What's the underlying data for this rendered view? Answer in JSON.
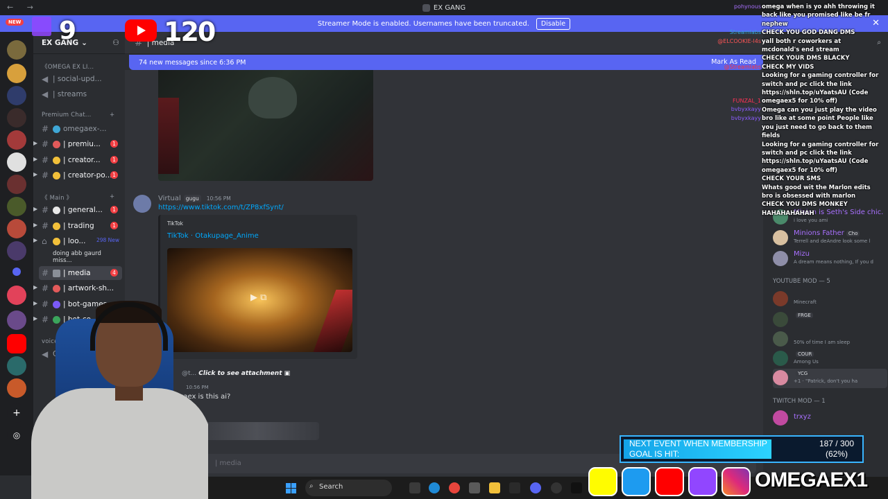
{
  "window": {
    "title": "EX GANG",
    "nav": "← →"
  },
  "banner": {
    "text": "Streamer Mode is enabled. Usernames have been truncated.",
    "button": "Disable",
    "close": "✕"
  },
  "overlay": {
    "twitch_count": "9",
    "youtube_count": "120",
    "new_badge": "NEW"
  },
  "server": {
    "name": "EX GANG"
  },
  "sidebar": {
    "categories": [
      {
        "label": "《OMEGA EX LI..."
      },
      {
        "label": "Premium Chat..."
      },
      {
        "label": "《 Main 》"
      },
      {
        "label": "voice chan"
      }
    ],
    "channels": [
      {
        "label": "| social-upd...",
        "color": "#949ba4"
      },
      {
        "label": "| streams",
        "color": "#949ba4"
      },
      {
        "label": "omegaex-...",
        "color": "#949ba4"
      },
      {
        "label": "| premiu...",
        "badge": "1"
      },
      {
        "label": "| creator...",
        "badge": "1"
      },
      {
        "label": "| creator-po...",
        "badge": "1"
      },
      {
        "label": "| general...",
        "badge": "1"
      },
      {
        "label": "| trading",
        "badge": "1"
      },
      {
        "label": "| loo...",
        "new": "298 New"
      },
      {
        "label": "doing abb gaurd miss..."
      },
      {
        "label": "| media",
        "badge": "4"
      },
      {
        "label": "| artwork-sh..."
      },
      {
        "label": "| bot-games"
      },
      {
        "label": "| bot-co..."
      },
      {
        "label": "Ga"
      }
    ]
  },
  "chat": {
    "channel_name": "| media",
    "new_messages": "74 new messages since 6:36 PM",
    "mark_read": "Mark As Read",
    "message": {
      "author": "Virtual",
      "tag": "gugu",
      "time": "10:56 PM",
      "link": "https://www.tiktok.com/t/ZP8xfSynt/",
      "embed_provider": "TikTok",
      "embed_title": "TikTok · Otakupage_Anime"
    },
    "attachment": {
      "mention": "@t...",
      "text": "Click to see attachment"
    },
    "message2": {
      "time": "10:56 PM",
      "text": "gaex is this ai?"
    },
    "input_placeholder": "| media"
  },
  "overlay_chat": {
    "names": [
      "pohynous",
      "",
      "",
      "Streamlabs",
      "@ELCOOKIE-l4s",
      "@Streamlabs",
      "",
      "FUNZAL_1",
      "bvbyxkayy",
      "bvbyxkayy"
    ],
    "name_colors": [
      "#a970ff",
      "#ff6666",
      "#5b7bff",
      "#3ad",
      "#ff5555",
      "#ff3333",
      "#7d6bff",
      "#ff3355",
      "#8b5cff",
      "#8b5cff"
    ],
    "lines": [
      "omega when is yo ahh throwing it back like you promised like be fr nephew",
      "CHECK YOU GOD DANG DMS",
      "yall both r coworkers at mcdonald's end stream",
      "CHECK YOUR DMS BLACKY",
      "CHECK MY VIDS",
      "Looking for a gaming controller for switch and pc click the link https://shln.top/uYaatsAU (Code omegaex5 for 10% off)",
      "Omega can you just play the video bro like at some point People like you just need to go back to them fields",
      "Looking for a gaming controller for switch and pc click the link https://shln.top/uYaatsAU (Code omegaex5 for 10% off)",
      "CHECK YOUR SMS",
      "Whats good wit the Marlon edits bro is obsessed with marlon",
      "CHECK YOU DMS MONKEY",
      "HAHAHAHAHAH"
    ]
  },
  "members": {
    "top": [
      {
        "name": "Minion is Seth's Side chic...",
        "status": "i love you ami",
        "color": "#a970ff"
      },
      {
        "name": "Minions Father",
        "clan": "Cho",
        "status": "Terrell and deAndre look some l",
        "color": "#a970ff"
      },
      {
        "name": "Mizu",
        "status": "A dream means nothing, If you d",
        "color": "#a970ff"
      }
    ],
    "group_youtube": "YOUTUBE MOD — 5",
    "youtube": [
      {
        "name": "",
        "status": "Minecraft",
        "color": "#c6283c"
      },
      {
        "name": "",
        "clan": "FRGE",
        "status": "",
        "color": "#c6283c"
      },
      {
        "name": "",
        "status": "50% of time I am sleep",
        "color": "#c6283c"
      },
      {
        "name": "",
        "clan": "COUR",
        "status": "Among Us",
        "color": "#c6283c"
      },
      {
        "name": "",
        "clan": "YCG",
        "status": "+1 · \"Patrick, don't you ha",
        "color": "#c6283c"
      }
    ],
    "group_twitch": "TWITCH MOD — 1",
    "twitch": [
      {
        "name": "trxyz",
        "color": "#a970ff"
      }
    ]
  },
  "goal": {
    "label_line1": "NEXT EVENT WHEN MEMBERSHIP",
    "label_line2": "GOAL IS HIT:",
    "count": "187 / 300",
    "percent": "(62%)",
    "fraction": 0.62
  },
  "taskbar": {
    "search": "Search"
  },
  "social": {
    "brand": "OMEGAEX1"
  }
}
